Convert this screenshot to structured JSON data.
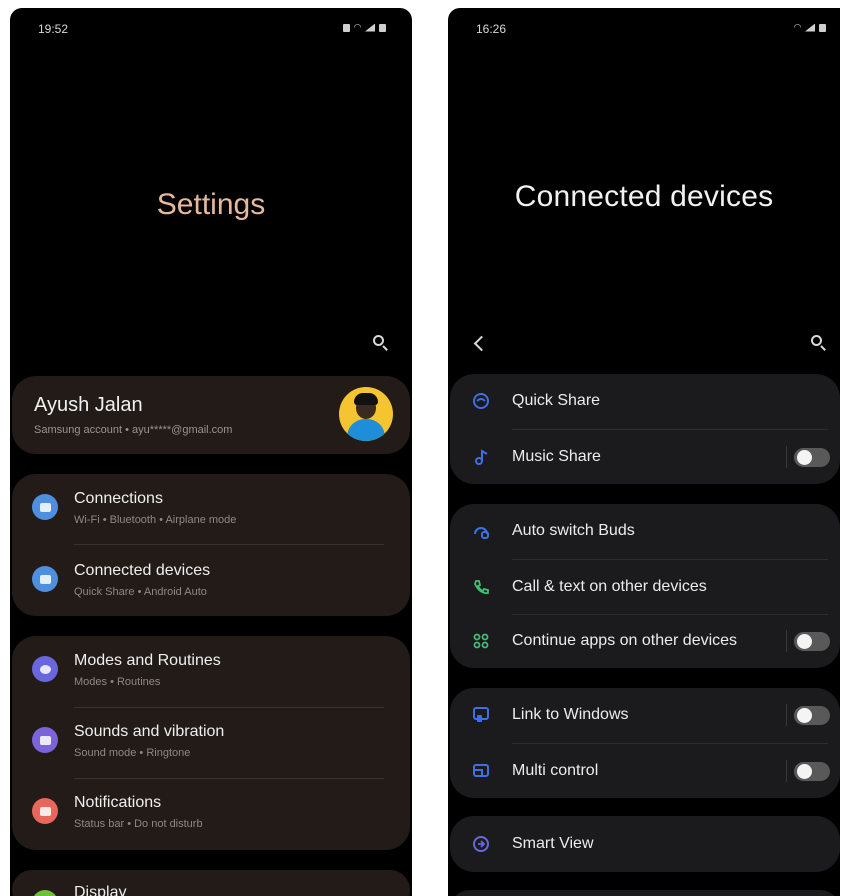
{
  "left_screen": {
    "status": {
      "time": "19:52"
    },
    "title": "Settings",
    "account": {
      "name": "Ayush Jalan",
      "subtitle": "Samsung account  •  ayu*****@gmail.com"
    },
    "groups": [
      {
        "items": [
          {
            "title": "Connections",
            "subtitle": "Wi-Fi  •  Bluetooth  •  Airplane mode",
            "icon": "wifi-icon",
            "color": "#4f8fe0"
          },
          {
            "title": "Connected devices",
            "subtitle": "Quick Share  •  Android Auto",
            "icon": "devices-icon",
            "color": "#4f8fe0"
          }
        ]
      },
      {
        "items": [
          {
            "title": "Modes and Routines",
            "subtitle": "Modes  •  Routines",
            "icon": "routines-icon",
            "color": "#6a67de"
          },
          {
            "title": "Sounds and vibration",
            "subtitle": "Sound mode  •  Ringtone",
            "icon": "volume-icon",
            "color": "#7b63d9"
          },
          {
            "title": "Notifications",
            "subtitle": "Status bar  •  Do not disturb",
            "icon": "notifications-icon",
            "color": "#e8665a"
          }
        ]
      },
      {
        "items": [
          {
            "title": "Display",
            "icon": "display-icon",
            "color": "#6fbf3a"
          }
        ]
      }
    ]
  },
  "right_screen": {
    "status": {
      "time": "16:26"
    },
    "title": "Connected devices",
    "groups": [
      {
        "items": [
          {
            "title": "Quick Share",
            "icon": "quick-share-icon",
            "color": "#3c6fe8",
            "toggle": null
          },
          {
            "title": "Music Share",
            "icon": "music-share-icon",
            "color": "#3c6fe8",
            "toggle": false
          }
        ]
      },
      {
        "items": [
          {
            "title": "Auto switch Buds",
            "icon": "buds-icon",
            "color": "#3c6fe8",
            "toggle": null
          },
          {
            "title": "Call & text on other devices",
            "icon": "call-text-icon",
            "color": "#3fbf6f",
            "toggle": null
          },
          {
            "title": "Continue apps on other devices",
            "icon": "continue-apps-icon",
            "color": "#3fbf6f",
            "toggle": false
          }
        ]
      },
      {
        "items": [
          {
            "title": "Link to Windows",
            "icon": "link-windows-icon",
            "color": "#3c6fe8",
            "toggle": false
          },
          {
            "title": "Multi control",
            "icon": "multi-control-icon",
            "color": "#3c6fe8",
            "toggle": false
          }
        ]
      },
      {
        "items": [
          {
            "title": "Smart View",
            "icon": "smart-view-icon",
            "color": "#6a67de",
            "toggle": null
          }
        ]
      }
    ]
  }
}
